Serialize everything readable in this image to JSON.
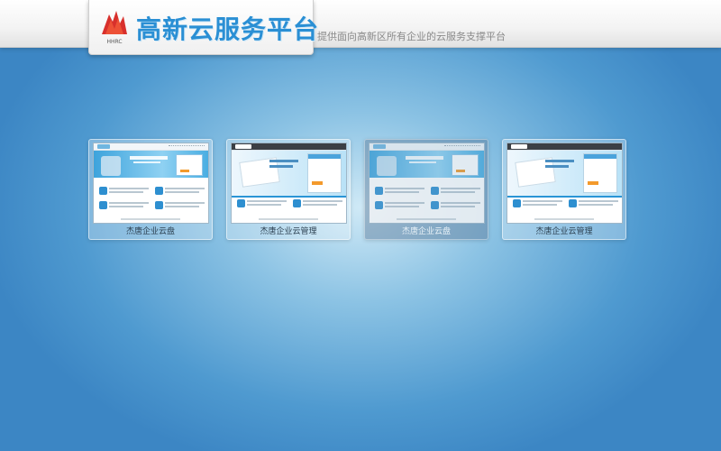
{
  "header": {
    "logo_text": "HHRC",
    "title": "高新云服务平台",
    "tagline": "提供面向高新区所有企业的云服务支撑平台"
  },
  "cards": [
    {
      "label": "杰唐企业云盘",
      "variant": "disk",
      "selected": false
    },
    {
      "label": "杰唐企业云管理",
      "variant": "manage",
      "selected": false
    },
    {
      "label": "杰唐企业云盘",
      "variant": "disk",
      "selected": true
    },
    {
      "label": "杰唐企业云管理",
      "variant": "manage",
      "selected": false
    }
  ],
  "colors": {
    "title_blue": "#2a8fd4",
    "background_blue": "#3c86c4",
    "accent_orange": "#f39a2c"
  }
}
